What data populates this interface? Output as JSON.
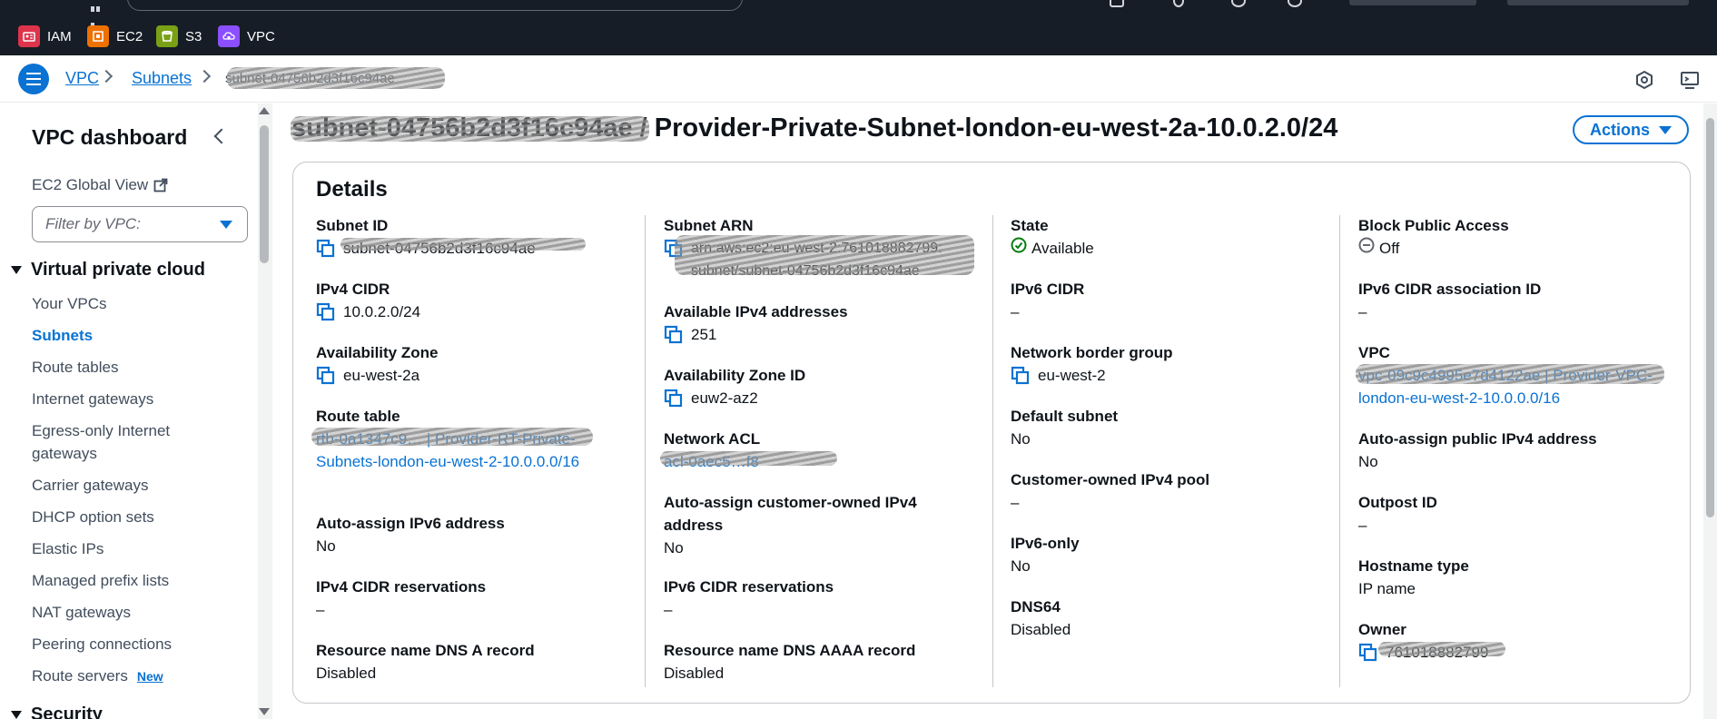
{
  "favorites": [
    {
      "label": "IAM",
      "color": "#dd344c"
    },
    {
      "label": "EC2",
      "color": "#ed7100"
    },
    {
      "label": "S3",
      "color": "#7aa116"
    },
    {
      "label": "VPC",
      "color": "#8c4fff"
    }
  ],
  "breadcrumb": {
    "items": [
      "VPC",
      "Subnets"
    ],
    "current": "subnet-04756b2d3f16c94ae"
  },
  "sidebar": {
    "title": "VPC dashboard",
    "global_view": "EC2 Global View",
    "filter_placeholder": "Filter by VPC:",
    "section": "Virtual private cloud",
    "items": [
      {
        "label": "Your VPCs"
      },
      {
        "label": "Subnets"
      },
      {
        "label": "Route tables"
      },
      {
        "label": "Internet gateways"
      },
      {
        "label": "Egress-only Internet gateways"
      },
      {
        "label": "Carrier gateways"
      },
      {
        "label": "DHCP option sets"
      },
      {
        "label": "Elastic IPs"
      },
      {
        "label": "Managed prefix lists"
      },
      {
        "label": "NAT gateways"
      },
      {
        "label": "Peering connections"
      },
      {
        "label": "Route servers"
      }
    ],
    "new_badge": "New",
    "next_section": "Security"
  },
  "page": {
    "title_prefix": "subnet-04756b2d3f16c94ae",
    "title_suffix": " / Provider-Private-Subnet-london-eu-west-2a-10.0.2.0/24",
    "actions_label": "Actions"
  },
  "details": {
    "title": "Details",
    "col1": {
      "subnet_id": {
        "label": "Subnet ID",
        "value": "subnet-04756b2d3f16c94ae"
      },
      "ipv4_cidr": {
        "label": "IPv4 CIDR",
        "value": "10.0.2.0/24"
      },
      "az": {
        "label": "Availability Zone",
        "value": "eu-west-2a"
      },
      "route_table": {
        "label": "Route table",
        "value": "rtb-0a1347c9… | Provider-RT-Private-Subnets-london-eu-west-2-10.0.0.0/16"
      },
      "auto_ipv6": {
        "label": "Auto-assign IPv6 address",
        "value": "No"
      },
      "ipv4_res": {
        "label": "IPv4 CIDR reservations",
        "value": "–"
      },
      "dns_a": {
        "label": "Resource name DNS A record",
        "value": "Disabled"
      }
    },
    "col2": {
      "subnet_arn": {
        "label": "Subnet ARN",
        "value": "arn:aws:ec2:eu-west-2:761018882799: subnet/subnet-04756b2d3f16c94ae"
      },
      "avail_ipv4": {
        "label": "Available IPv4 addresses",
        "value": "251"
      },
      "az_id": {
        "label": "Availability Zone ID",
        "value": "euw2-az2"
      },
      "nacl": {
        "label": "Network ACL",
        "value": "acl-0aec5…f8"
      },
      "auto_coip": {
        "label": "Auto-assign customer-owned IPv4 address",
        "value": "No"
      },
      "ipv6_res": {
        "label": "IPv6 CIDR reservations",
        "value": "–"
      },
      "dns_aaaa": {
        "label": "Resource name DNS AAAA record",
        "value": "Disabled"
      }
    },
    "col3": {
      "state": {
        "label": "State",
        "value": "Available"
      },
      "ipv6_cidr": {
        "label": "IPv6 CIDR",
        "value": "–"
      },
      "nbg": {
        "label": "Network border group",
        "value": "eu-west-2"
      },
      "default_subnet": {
        "label": "Default subnet",
        "value": "No"
      },
      "coip_pool": {
        "label": "Customer-owned IPv4 pool",
        "value": "–"
      },
      "ipv6_only": {
        "label": "IPv6-only",
        "value": "No"
      },
      "dns64": {
        "label": "DNS64",
        "value": "Disabled"
      }
    },
    "col4": {
      "bpa": {
        "label": "Block Public Access",
        "value": "Off"
      },
      "ipv6_assoc": {
        "label": "IPv6 CIDR association ID",
        "value": "–"
      },
      "vpc": {
        "label": "VPC",
        "value": "vpc-09c9c4995e7d4122ae | Provider-VPC-london-eu-west-2-10.0.0.0/16"
      },
      "auto_public": {
        "label": "Auto-assign public IPv4 address",
        "value": "No"
      },
      "outpost": {
        "label": "Outpost ID",
        "value": "–"
      },
      "hostname": {
        "label": "Hostname type",
        "value": "IP name"
      },
      "owner": {
        "label": "Owner",
        "value": "761018882799"
      }
    }
  }
}
